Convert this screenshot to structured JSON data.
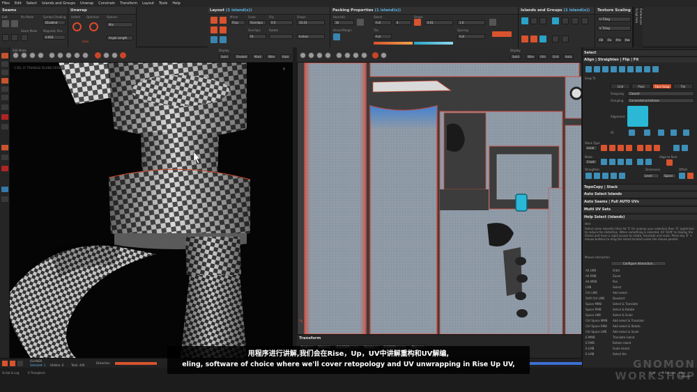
{
  "menu": [
    "Files",
    "Edit",
    "Select",
    "Islands and Groups",
    "Unwrap",
    "Constrain",
    "Transform",
    "Layout",
    "Tools",
    "Help"
  ],
  "panels": {
    "seams": {
      "title": "Seams",
      "labels": [
        "Edit",
        "Pin Mode",
        "Symbol Shading",
        "Seam Mode",
        "Unpin",
        "Magnetic Pins"
      ],
      "dropdown": "Disabled",
      "value": "0.003"
    },
    "unwrap": {
      "title": "Unwrap",
      "labels": [
        "Unfold",
        "Optimize",
        "Options",
        "Auto",
        "Angle Length"
      ],
      "dropdowns": [
        "Mix",
        "Angle Length"
      ]
    },
    "layout": {
      "title": "Layout",
      "selection": "(1 island(s))",
      "labels": [
        "Mirror",
        "Scale",
        "Flip",
        "Shape",
        "Overlaps",
        "Rotate",
        "Fit"
      ],
      "values": [
        "Flips",
        "Overlaps",
        "0.0",
        "Fit",
        "10.24",
        "Inches"
      ]
    },
    "packing": {
      "title": "Packing Properties",
      "selection": "(1 island(s))",
      "labels": [
        "Heuristic",
        "Select",
        "Shape",
        "Island Margin",
        "Tile",
        "Spacing"
      ],
      "values": [
        "16",
        "Full",
        "4",
        "0.01",
        "1.0",
        "Full",
        "Full"
      ]
    },
    "islands": {
      "title": "Islands and Groups",
      "selection": "(1 island(s))"
    },
    "texture": {
      "title": "Texture Scaling",
      "labels": [
        "U Tiling",
        "V Tiling",
        "Fill",
        "Fix",
        "Pre",
        "Rec"
      ]
    }
  },
  "vertical_tabs": [
    "Script Hub",
    "Preferences"
  ],
  "viewport3d": {
    "hint": "3 SEL 1F TRIANGLE ISLAND GROUPS",
    "axis_label": "y",
    "buttons": [
      "Solid",
      "Shaded",
      "Mark",
      "Tex",
      "Wire",
      "Auto",
      "Grid"
    ],
    "labels": [
      "Edit Mode",
      "Filter",
      "Display",
      "Cut",
      "Select"
    ]
  },
  "viewportuv": {
    "buttons": [
      "Solid",
      "Wire",
      "UVs",
      "Grid",
      "Map",
      "Auto",
      "Mark"
    ],
    "labels": [
      "Edit Mode",
      "Display",
      "Grid Opt",
      "Colors"
    ]
  },
  "uv_transform": {
    "title": "Transform",
    "fields": [
      "Scale",
      "Move",
      "0.0.0000",
      "Rotate",
      "0.00000",
      "Flip"
    ]
  },
  "right_panel": {
    "select_title": "Select",
    "tools_title": "Align | Straighten | Flip | Fit",
    "snap_labels": [
      "Snap To",
      "Grid",
      "Pixel",
      "Face Snap",
      "Tile",
      "Snapping",
      "Grouping"
    ],
    "snap_values": [
      "Closest",
      "Connected primitives"
    ],
    "alignment_label": "Alignment",
    "fit_labels": [
      "Fit",
      "Local",
      "Stack Type",
      "Mode",
      "Crash",
      "Align to Rect",
      "Dimension",
      "Offset",
      "Straighten",
      "Level",
      "Space"
    ],
    "sections": [
      "TopoCopy | Stack",
      "Auto Select Islands",
      "Auto Seams | Full AUTO UVs",
      "Multi UV Sets",
      "Help Select (Islands)"
    ],
    "help_label": "Hint",
    "help_text": "Select some island(s) then hit 'S' for unwrap your selection then 'O' (optimize) to reduce the distortion. When something is selected, hit 'Shift' to display the Gizmo and have a rapid access to rotate, translate and scale. Press key 'E' + mouse buttons to drag the island located under the mouse pointer.",
    "mouse_label": "Mouse interaction",
    "configure_button": "Configure Interaction...",
    "shortcuts": [
      {
        "key": "Alt LMB",
        "action": "Orbit"
      },
      {
        "key": "Alt RMB",
        "action": "Zoom"
      },
      {
        "key": "Alt MMB",
        "action": "Pan"
      },
      {
        "key": "LMB",
        "action": "Select"
      },
      {
        "key": "Ctrl LMB",
        "action": "Add select"
      },
      {
        "key": "Shift Ctrl LMB",
        "action": "Deselect"
      },
      {
        "key": "Space MMB",
        "action": "Select & Translate"
      },
      {
        "key": "Space RMB",
        "action": "Select & Rotate"
      },
      {
        "key": "Space LMB",
        "action": "Select & Scale"
      },
      {
        "key": "Ctrl Space MMB",
        "action": "Add select & Translate"
      },
      {
        "key": "Ctrl Space RMB",
        "action": "Add select & Rotate"
      },
      {
        "key": "Ctrl Space LMB",
        "action": "Add select & Scale"
      },
      {
        "key": "E-MMB",
        "action": "Translate island"
      },
      {
        "key": "E-RMB",
        "action": "Rotate island"
      },
      {
        "key": "E-LMB",
        "action": "Scale island"
      },
      {
        "key": "E-LMB",
        "action": "Select tile"
      }
    ]
  },
  "statusbar": {
    "islands_label": "ISLANDS",
    "selected": "Selected: 1",
    "hidden": "Hidden: 0",
    "total": "Total: 440",
    "distortion": "Distortion"
  },
  "bottombar": {
    "log": "Script & Log",
    "stats": "0 Triangles/s",
    "right": [
      "Grid",
      "R Release",
      "View Release"
    ]
  },
  "subtitles": {
    "zh": "用程序进行讲解,我们会在Rise，Up，UV中讲解重构和UV解编,",
    "en": "eling, software of choice where we'll cover retopology and UV unwrapping in Rise Up UV,"
  },
  "watermark": [
    "GNOMON",
    "WORKSHOP"
  ],
  "colors": {
    "accent_orange": "#d8532e",
    "accent_blue": "#3d8fb8",
    "highlight_cyan": "#2ab8d6"
  }
}
